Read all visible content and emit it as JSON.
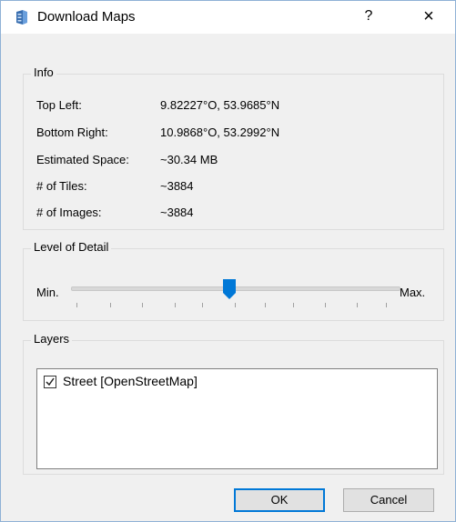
{
  "window": {
    "title": "Download Maps",
    "help_label": "?",
    "close_label": "×"
  },
  "info": {
    "label": "Info",
    "rows": [
      {
        "label": "Top Left:",
        "value": "9.82227°O, 53.9685°N"
      },
      {
        "label": "Bottom Right:",
        "value": "10.9868°O, 53.2992°N"
      },
      {
        "label": "Estimated Space:",
        "value": "~30.34 MB"
      },
      {
        "label": "# of Tiles:",
        "value": "~3884"
      },
      {
        "label": "# of Images:",
        "value": "~3884"
      }
    ]
  },
  "level_of_detail": {
    "label": "Level of Detail",
    "min_label": "Min.",
    "max_label": "Max.",
    "value_fraction": 0.5
  },
  "layers": {
    "label": "Layers",
    "items": [
      {
        "label": "Street [OpenStreetMap]",
        "checked": true
      }
    ]
  },
  "buttons": {
    "ok_label": "OK",
    "cancel_label": "Cancel"
  },
  "colors": {
    "accent": "#0078d7",
    "window_border": "#8fb1d6"
  }
}
